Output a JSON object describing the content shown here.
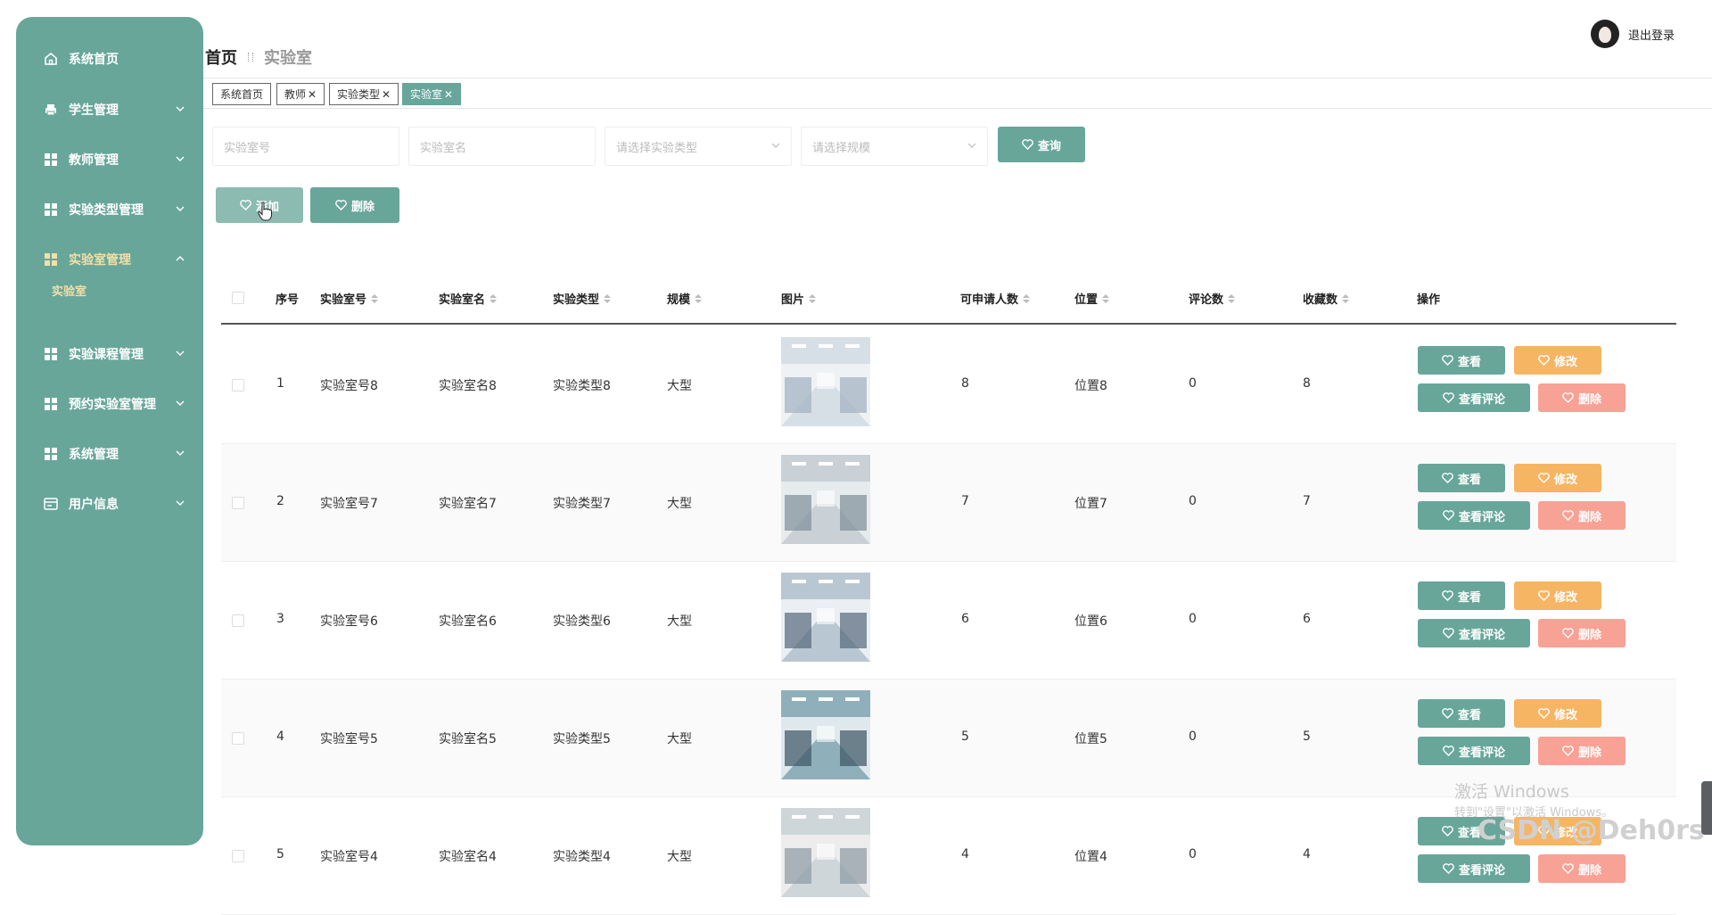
{
  "sidebar": {
    "items": [
      {
        "label": "系统首页",
        "icon": "home-icon"
      },
      {
        "label": "学生管理",
        "icon": "printer-icon"
      },
      {
        "label": "教师管理",
        "icon": "grid-icon"
      },
      {
        "label": "实验类型管理",
        "icon": "grid-icon"
      },
      {
        "label": "实验室管理",
        "icon": "grid-icon"
      },
      {
        "label": "实验课程管理",
        "icon": "grid-icon"
      },
      {
        "label": "预约实验室管理",
        "icon": "grid-icon"
      },
      {
        "label": "系统管理",
        "icon": "grid-icon"
      },
      {
        "label": "用户信息",
        "icon": "card-icon"
      }
    ],
    "sub_item": "实验室"
  },
  "header": {
    "breadcrumb_home": "首页",
    "breadcrumb_current": "实验室",
    "logout": "退出登录"
  },
  "tags": [
    "系统首页",
    "教师",
    "实验类型",
    "实验室"
  ],
  "search": {
    "room_no_placeholder": "实验室号",
    "room_name_placeholder": "实验室名",
    "type_placeholder": "请选择实验类型",
    "scale_placeholder": "请选择规模",
    "query_button": "查询"
  },
  "actions": {
    "add": "添加",
    "delete": "删除"
  },
  "table": {
    "headers": [
      "序号",
      "实验室号",
      "实验室名",
      "实验类型",
      "规模",
      "图片",
      "可申请人数",
      "位置",
      "评论数",
      "收藏数",
      "操作"
    ],
    "row_buttons": {
      "view": "查看",
      "edit": "修改",
      "view_comments": "查看评论",
      "delete": "删除"
    },
    "rows": [
      {
        "index": "1",
        "room_no": "实验室号8",
        "room_name": "实验室名8",
        "type": "实验类型8",
        "scale": "大型",
        "capacity": "8",
        "location": "位置8",
        "comments": "0",
        "favorites": "8"
      },
      {
        "index": "2",
        "room_no": "实验室号7",
        "room_name": "实验室名7",
        "type": "实验类型7",
        "scale": "大型",
        "capacity": "7",
        "location": "位置7",
        "comments": "0",
        "favorites": "7"
      },
      {
        "index": "3",
        "room_no": "实验室号6",
        "room_name": "实验室名6",
        "type": "实验类型6",
        "scale": "大型",
        "capacity": "6",
        "location": "位置6",
        "comments": "0",
        "favorites": "6"
      },
      {
        "index": "4",
        "room_no": "实验室号5",
        "room_name": "实验室名5",
        "type": "实验类型5",
        "scale": "大型",
        "capacity": "5",
        "location": "位置5",
        "comments": "0",
        "favorites": "5"
      },
      {
        "index": "5",
        "room_no": "实验室号4",
        "room_name": "实验室名4",
        "type": "实验类型4",
        "scale": "大型",
        "capacity": "4",
        "location": "位置4",
        "comments": "0",
        "favorites": "4"
      }
    ]
  },
  "overlay": {
    "activate_title": "激活 Windows",
    "activate_hint": "转到\"设置\"以激活 Windows。",
    "csdn": "CSDN @Deh0rs"
  },
  "colors": {
    "primary": "#68a69a",
    "orange": "#f6b563",
    "pink": "#f8a195",
    "submenu_active": "#f4dfa6"
  }
}
